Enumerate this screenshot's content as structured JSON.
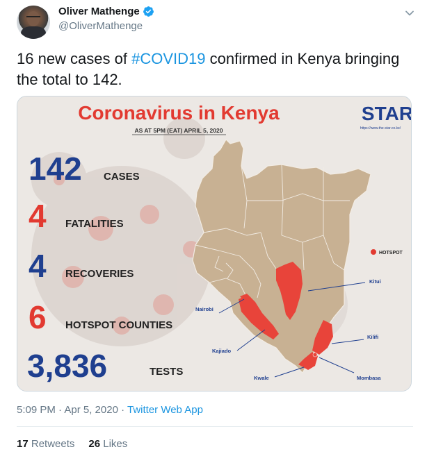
{
  "author": {
    "name": "Oliver Mathenge",
    "handle": "@OliverMathenge"
  },
  "tweet": {
    "text_before": "16 new cases of ",
    "hashtag": "#COVID19",
    "text_after": " confirmed in Kenya bringing the total to 142."
  },
  "infographic": {
    "title": "Coronavirus in Kenya",
    "subtitle": "AS AT 5PM (EAT) APRIL 5, 2020",
    "logo": "STAR",
    "url": "https://www.the-star.co.ke/",
    "stats": [
      {
        "value": "142",
        "label": "CASES",
        "value_color": "#1f3f8f"
      },
      {
        "value": "4",
        "label": "FATALITIES",
        "value_color": "#e23a31"
      },
      {
        "value": "4",
        "label": "RECOVERIES",
        "value_color": "#1f3f8f"
      },
      {
        "value": "6",
        "label": "HOTSPOT COUNTIES",
        "value_color": "#e23a31"
      },
      {
        "value": "3,836",
        "label": "TESTS",
        "value_color": "#1f3f8f"
      }
    ],
    "legend": "HOTSPOT",
    "map_labels": {
      "nairobi": "Nairobi",
      "kajiado": "Kajiado",
      "kwale": "Kwale",
      "kitui": "Kitui",
      "kilifi": "Kilifi",
      "mombasa": "Mombasa"
    },
    "colors": {
      "map_land": "#c8b193",
      "hotspot": "#e8443a",
      "title_red": "#e23a31",
      "navy": "#1f3f8f"
    }
  },
  "meta": {
    "time": "5:09 PM · Apr 5, 2020 · ",
    "app": "Twitter Web App"
  },
  "stats": {
    "retweets_count": "17",
    "retweets_label": "Retweets",
    "likes_count": "26",
    "likes_label": "Likes"
  }
}
